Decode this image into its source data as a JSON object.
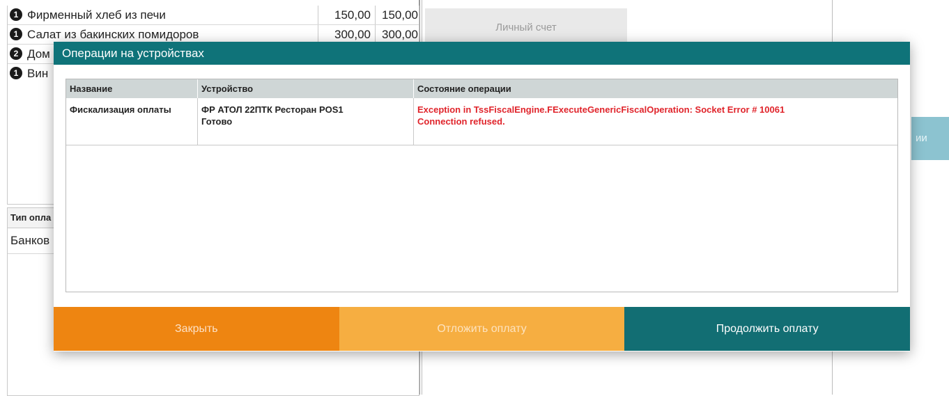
{
  "order": {
    "items": [
      {
        "qty": "1",
        "name": "Фирменный хлеб из печи",
        "price": "150,00",
        "sum": "150,00"
      },
      {
        "qty": "1",
        "name": "Салат из бакинских помидоров",
        "price": "300,00",
        "sum": "300,00"
      },
      {
        "qty": "2",
        "name": "Дом",
        "price": "",
        "sum": ""
      },
      {
        "qty": "1",
        "name": "Вин",
        "price": "",
        "sum": ""
      }
    ]
  },
  "personal_account_label": "Личный счет",
  "right_button_label": "ии",
  "payment_type": {
    "header": "Тип опла",
    "value": "Банков"
  },
  "modal": {
    "title": "Операции на устройствах",
    "columns": [
      "Название",
      "Устройство",
      "Состояние операции"
    ],
    "rows": [
      {
        "name": "Фискализация оплаты",
        "device": "ФР АТОЛ 22ПТК Ресторан POS1",
        "device_status": "Готово",
        "state_line1": "Exception in TssFiscalEngine.FExecuteGenericFiscalOperation: Socket Error # 10061",
        "state_line2": "Connection refused."
      }
    ],
    "buttons": {
      "close": "Закрыть",
      "postpone": "Отложить оплату",
      "continue": "Продолжить оплату"
    }
  },
  "colors": {
    "teal": "#0f7379",
    "orange": "#ee8511",
    "light_orange": "#f6ae41",
    "error_red": "#e0242b"
  }
}
